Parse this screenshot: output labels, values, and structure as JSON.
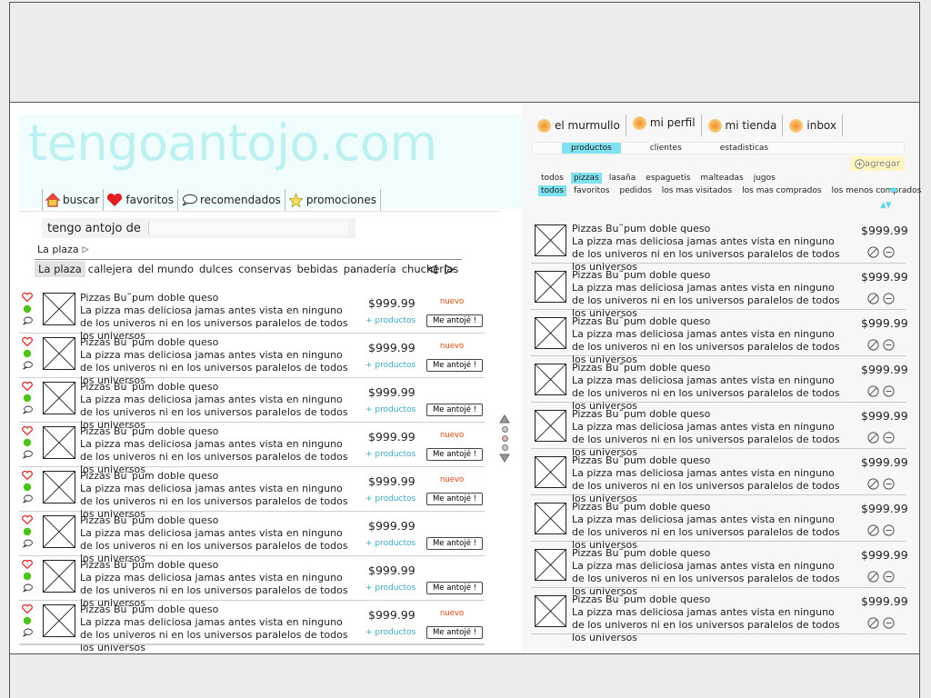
{
  "logo": "tengoantojo.com",
  "mainnav": [
    {
      "label": "buscar",
      "icon": "house-icon"
    },
    {
      "label": "favoritos",
      "icon": "heart-icon"
    },
    {
      "label": "recomendados",
      "icon": "speech-bubble-icon"
    },
    {
      "label": "promociones",
      "icon": "star-icon"
    }
  ],
  "craving": {
    "label": "tengo antojo de",
    "value": ""
  },
  "plaza": {
    "heading": "La plaza",
    "categories": [
      "La plaza",
      "callejera",
      "del mundo",
      "dulces",
      "conservas",
      "bebidas",
      "panadería",
      "chucherías"
    ]
  },
  "left_items": [
    {
      "title": "Pizzas Bu˜pum doble queso",
      "desc": "La pizza mas deliciosa jamas antes vista en ninguno de los univeros ni en los universos paralelos de todos los universos",
      "price": "$999.99",
      "badge": "nuevo",
      "more": "+ productos",
      "button": "Me antojé !"
    },
    {
      "title": "Pizzas Bu˜pum doble queso",
      "desc": "La pizza mas deliciosa jamas antes vista en ninguno de los univeros ni en los universos paralelos de todos los universos",
      "price": "$999.99",
      "badge": "nuevo",
      "more": "+ productos",
      "button": "Me antojé !"
    },
    {
      "title": "Pizzas Bu˜pum doble queso",
      "desc": "La pizza mas deliciosa jamas antes vista en ninguno de los univeros ni en los universos paralelos de todos los universos",
      "price": "$999.99",
      "badge": "",
      "more": "+ productos",
      "button": "Me antojé !"
    },
    {
      "title": "Pizzas Bu˜pum doble queso",
      "desc": "La pizza mas deliciosa jamas antes vista en ninguno de los univeros ni en los universos paralelos de todos los universos",
      "price": "$999.99",
      "badge": "nuevo",
      "more": "+ productos",
      "button": "Me antojé !"
    },
    {
      "title": "Pizzas Bu˜pum doble queso",
      "desc": "La pizza mas deliciosa jamas antes vista en ninguno de los univeros ni en los universos paralelos de todos los universos",
      "price": "$999.99",
      "badge": "nuevo",
      "more": "+ productos",
      "button": "Me antojé !"
    },
    {
      "title": "Pizzas Bu˜pum doble queso",
      "desc": "La pizza mas deliciosa jamas antes vista en ninguno de los univeros ni en los universos paralelos de todos los universos",
      "price": "$999.99",
      "badge": "",
      "more": "+ productos",
      "button": "Me antojé !"
    },
    {
      "title": "Pizzas Bu˜pum doble queso",
      "desc": "La pizza mas deliciosa jamas antes vista en ninguno de los univeros ni en los universos paralelos de todos los universos",
      "price": "$999.99",
      "badge": "",
      "more": "+ productos",
      "button": "Me antojé !"
    },
    {
      "title": "Pizzas Bu˜pum doble queso",
      "desc": "La pizza mas deliciosa jamas antes vista en ninguno de los univeros ni en los universos paralelos de todos los universos",
      "price": "$999.99",
      "badge": "nuevo",
      "more": "+ productos",
      "button": "Me antojé !"
    }
  ],
  "pager": {
    "active_page": 2,
    "pages": 3
  },
  "right_tabs": [
    "el murmullo",
    "mi perfil",
    "mi tienda",
    "inbox"
  ],
  "sub_tabs": [
    "productos",
    "clientes",
    "estadisticas"
  ],
  "sub_tab_active": "productos",
  "agregar": "agregar",
  "filter_products": [
    "todos",
    "pizzas",
    "lasaña",
    "espaguetis",
    "malteadas",
    "jugos"
  ],
  "filter_products_active": "pizzas",
  "filter_status": [
    "todos",
    "favoritos",
    "pedidos",
    "los mas visitados",
    "los mas comprados",
    "los menos comprados"
  ],
  "filter_status_active": "todos",
  "right_items": [
    {
      "title": "Pizzas Bu˜pum doble queso",
      "desc": "La pizza mas deliciosa jamas antes vista en ninguno de los univeros ni en los universos paralelos de todos los universos",
      "price": "$999.99"
    },
    {
      "title": "Pizzas Bu˜pum doble queso",
      "desc": "La pizza mas deliciosa jamas antes vista en ninguno de los univeros ni en los universos paralelos de todos los universos",
      "price": "$999.99"
    },
    {
      "title": "Pizzas Bu˜pum doble queso",
      "desc": "La pizza mas deliciosa jamas antes vista en ninguno de los univeros ni en los universos paralelos de todos los universos",
      "price": "$999.99"
    },
    {
      "title": "Pizzas Bu˜pum doble queso",
      "desc": "La pizza mas deliciosa jamas antes vista en ninguno de los univeros ni en los universos paralelos de todos los universos",
      "price": "$999.99"
    },
    {
      "title": "Pizzas Bu˜pum doble queso",
      "desc": "La pizza mas deliciosa jamas antes vista en ninguno de los univeros ni en los universos paralelos de todos los universos",
      "price": "$999.99"
    },
    {
      "title": "Pizzas Bu˜pum doble queso",
      "desc": "La pizza mas deliciosa jamas antes vista en ninguno de los univeros ni en los universos paralelos de todos los universos",
      "price": "$999.99"
    },
    {
      "title": "Pizzas Bu˜pum doble queso",
      "desc": "La pizza mas deliciosa jamas antes vista en ninguno de los univeros ni en los universos paralelos de todos los universos",
      "price": "$999.99"
    },
    {
      "title": "Pizzas Bu˜pum doble queso",
      "desc": "La pizza mas deliciosa jamas antes vista en ninguno de los univeros ni en los universos paralelos de todos los universos",
      "price": "$999.99"
    },
    {
      "title": "Pizzas Bu˜pum doble queso",
      "desc": "La pizza mas deliciosa jamas antes vista en ninguno de los univeros ni en los universos paralelos de todos los universos",
      "price": "$999.99"
    }
  ],
  "colors": {
    "accent_cyan": "#7fe2f0",
    "logo": "#bdf0f0",
    "badge": "#d9480f",
    "link": "#3aa8c8",
    "heart": "#e02020",
    "status_dot": "#4cc21a"
  }
}
